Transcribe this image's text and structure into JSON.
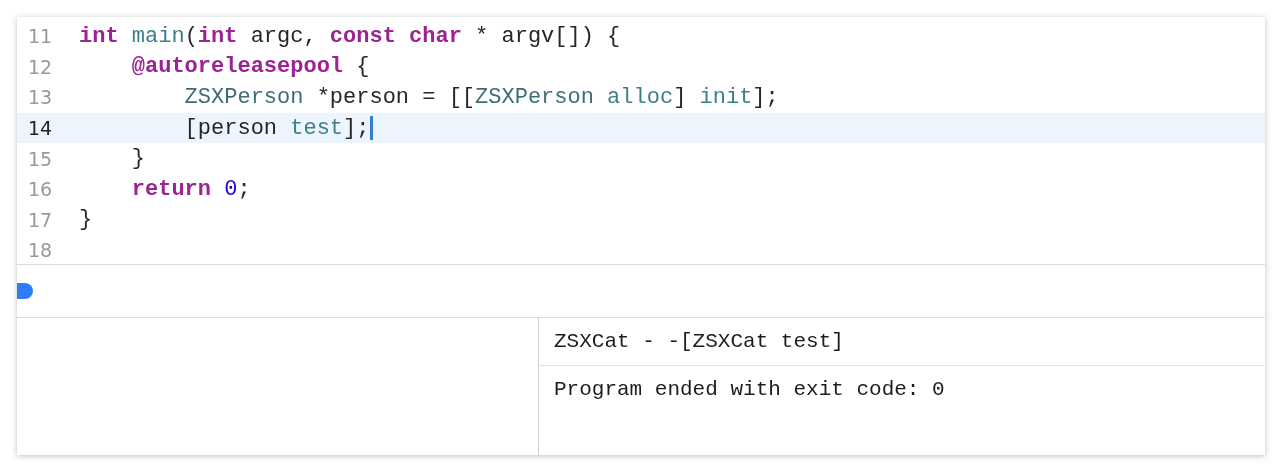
{
  "editor": {
    "lines": [
      {
        "number": "11",
        "current": false,
        "tokens": [
          {
            "text": "int",
            "kind": "keyword"
          },
          {
            "text": " main",
            "kind": "function"
          },
          {
            "text": "(",
            "kind": "plain"
          },
          {
            "text": "int",
            "kind": "keyword"
          },
          {
            "text": " argc, ",
            "kind": "plain"
          },
          {
            "text": "const",
            "kind": "keyword"
          },
          {
            "text": " char",
            "kind": "keyword"
          },
          {
            "text": " * argv[]) {",
            "kind": "plain"
          }
        ]
      },
      {
        "number": "12",
        "current": false,
        "tokens": [
          {
            "text": "    @autoreleasepool",
            "kind": "keyword"
          },
          {
            "text": " {",
            "kind": "plain"
          }
        ]
      },
      {
        "number": "13",
        "current": false,
        "tokens": [
          {
            "text": "        ZSXPerson",
            "kind": "type"
          },
          {
            "text": " *person = [[",
            "kind": "plain"
          },
          {
            "text": "ZSXPerson",
            "kind": "type"
          },
          {
            "text": " alloc",
            "kind": "method"
          },
          {
            "text": "] ",
            "kind": "plain"
          },
          {
            "text": "init",
            "kind": "method"
          },
          {
            "text": "];",
            "kind": "plain"
          }
        ]
      },
      {
        "number": "14",
        "current": true,
        "tokens": [
          {
            "text": "        [person ",
            "kind": "plain"
          },
          {
            "text": "test",
            "kind": "method"
          },
          {
            "text": "];",
            "kind": "plain"
          }
        ]
      },
      {
        "number": "15",
        "current": false,
        "tokens": [
          {
            "text": "    }",
            "kind": "plain"
          }
        ]
      },
      {
        "number": "16",
        "current": false,
        "tokens": [
          {
            "text": "    return",
            "kind": "keyword"
          },
          {
            "text": " 0",
            "kind": "number"
          },
          {
            "text": ";",
            "kind": "plain"
          }
        ]
      },
      {
        "number": "17",
        "current": false,
        "tokens": [
          {
            "text": "}",
            "kind": "plain"
          }
        ]
      },
      {
        "number": "18",
        "current": false
      }
    ]
  },
  "console": {
    "lines": [
      "ZSXCat - -[ZSXCat test]",
      "Program ended with exit code: 0"
    ]
  }
}
